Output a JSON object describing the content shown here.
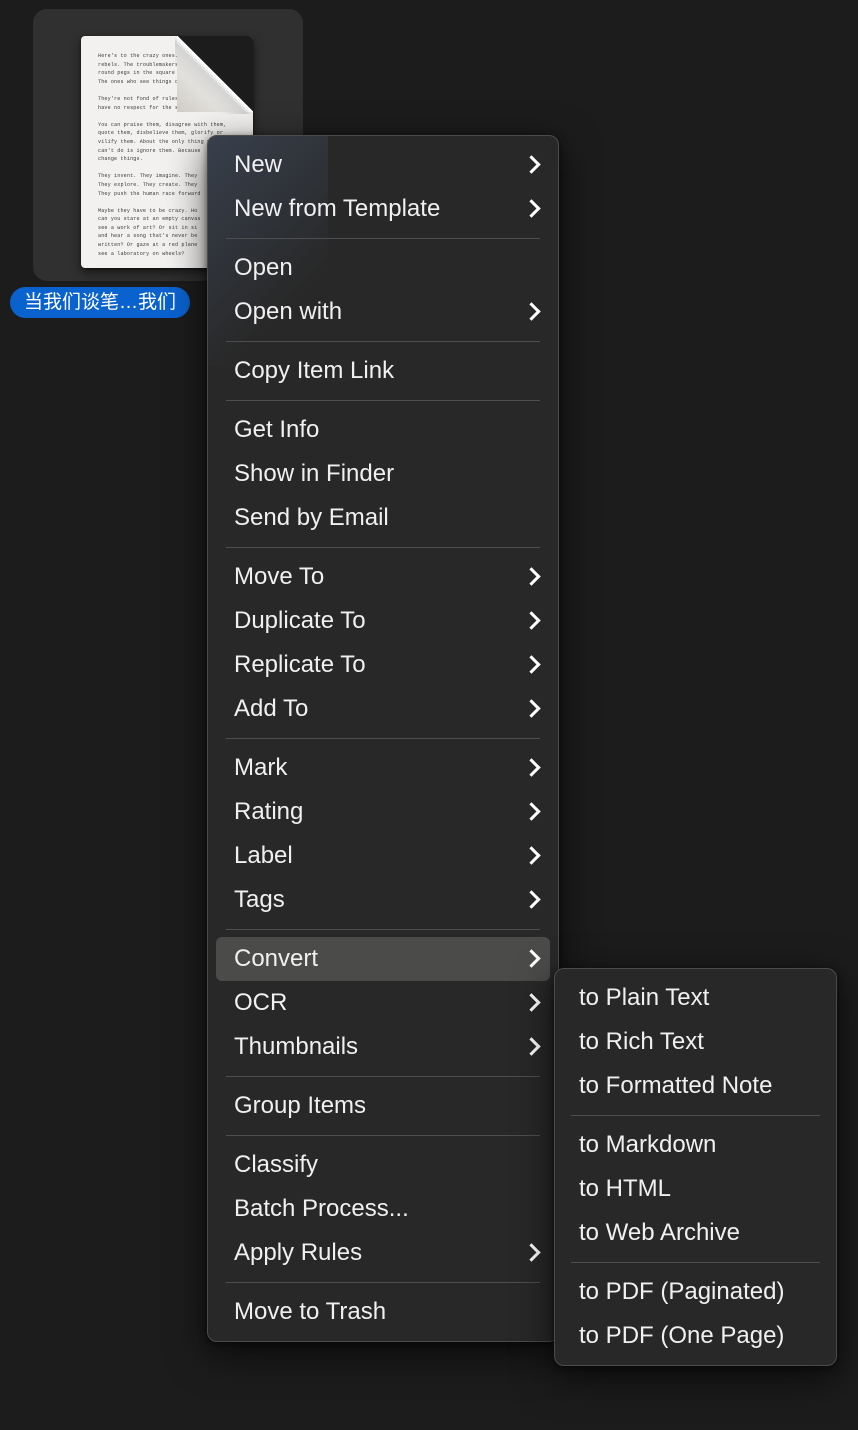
{
  "desktop": {
    "background_color": "#1c1c1c"
  },
  "item": {
    "tile_color": "#303030",
    "label": "当我们谈笔…我们",
    "label_color": "#0a62cf",
    "document_text": "Here's to the crazy ones. T\nrebels. The troublemakers.\nround pegs in the square h\nThe ones who see things di\n\nThey're not fond of rules. And they\nhave no respect for the status quo.\n\nYou can praise them, disagree with them,\nquote them, disbelieve them, glorify or\nvilify them. About the only thing you\ncan't do is ignore them. Because\nchange things.\n\nThey invent. They imagine. They\nThey explore. They create. They\nThey push the human race forward\n\nMaybe they have to be crazy. Ho\ncan you stare at an empty canvas\nsee a work of art? Or sit in si\nand hear a song that's never be\nwritten? Or gaze at a red plane\nsee a laboratory on wheels?"
  },
  "context_menu": {
    "highlight_color": "#4b4b49",
    "background_color": "#282828",
    "groups": [
      {
        "items": [
          {
            "label": "New",
            "submenu": true
          },
          {
            "label": "New from Template",
            "submenu": true
          }
        ]
      },
      {
        "items": [
          {
            "label": "Open",
            "submenu": false
          },
          {
            "label": "Open with",
            "submenu": true
          }
        ]
      },
      {
        "items": [
          {
            "label": "Copy Item Link",
            "submenu": false
          }
        ]
      },
      {
        "items": [
          {
            "label": "Get Info",
            "submenu": false
          },
          {
            "label": "Show in Finder",
            "submenu": false
          },
          {
            "label": "Send by Email",
            "submenu": false
          }
        ]
      },
      {
        "items": [
          {
            "label": "Move To",
            "submenu": true
          },
          {
            "label": "Duplicate To",
            "submenu": true
          },
          {
            "label": "Replicate To",
            "submenu": true
          },
          {
            "label": "Add To",
            "submenu": true
          }
        ]
      },
      {
        "items": [
          {
            "label": "Mark",
            "submenu": true
          },
          {
            "label": "Rating",
            "submenu": true
          },
          {
            "label": "Label",
            "submenu": true
          },
          {
            "label": "Tags",
            "submenu": true
          }
        ]
      },
      {
        "items": [
          {
            "label": "Convert",
            "submenu": true,
            "selected": true
          },
          {
            "label": "OCR",
            "submenu": true
          },
          {
            "label": "Thumbnails",
            "submenu": true
          }
        ]
      },
      {
        "items": [
          {
            "label": "Group Items",
            "submenu": false
          }
        ]
      },
      {
        "items": [
          {
            "label": "Classify",
            "submenu": false
          },
          {
            "label": "Batch Process...",
            "submenu": false
          },
          {
            "label": "Apply Rules",
            "submenu": true
          }
        ]
      },
      {
        "items": [
          {
            "label": "Move to Trash",
            "submenu": false
          }
        ]
      }
    ]
  },
  "convert_submenu": {
    "groups": [
      {
        "items": [
          {
            "label": "to Plain Text",
            "submenu": false
          },
          {
            "label": "to Rich Text",
            "submenu": false
          },
          {
            "label": "to Formatted Note",
            "submenu": false
          }
        ]
      },
      {
        "items": [
          {
            "label": "to Markdown",
            "submenu": false
          },
          {
            "label": "to HTML",
            "submenu": false
          },
          {
            "label": "to Web Archive",
            "submenu": false
          }
        ]
      },
      {
        "items": [
          {
            "label": "to PDF (Paginated)",
            "submenu": false
          },
          {
            "label": "to PDF (One Page)",
            "submenu": false
          }
        ]
      }
    ]
  }
}
